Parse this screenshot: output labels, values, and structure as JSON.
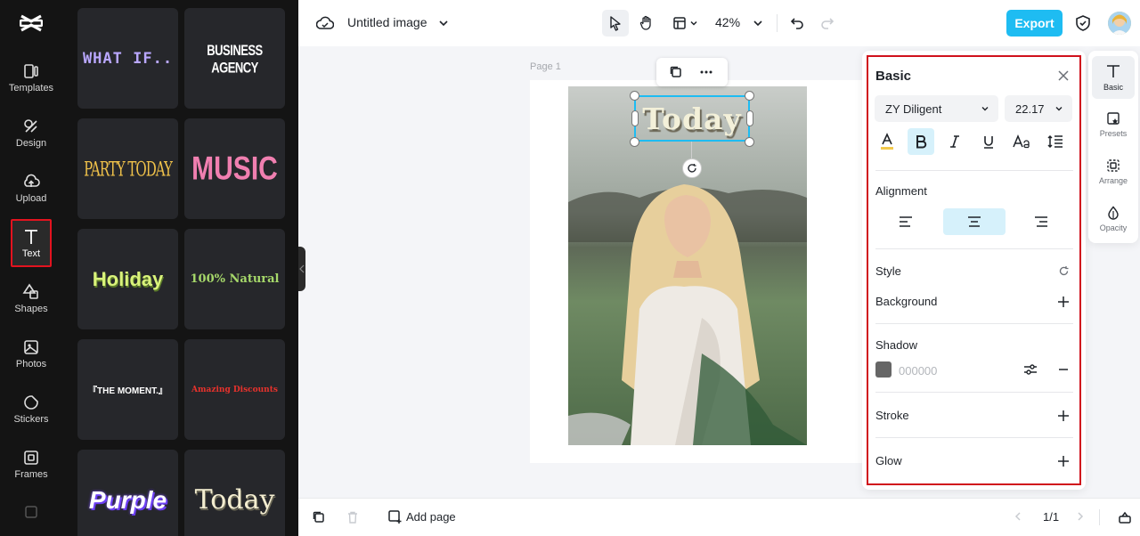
{
  "rail": {
    "items": [
      {
        "label": "Templates",
        "icon": "templates-icon"
      },
      {
        "label": "Design",
        "icon": "design-icon"
      },
      {
        "label": "Upload",
        "icon": "upload-icon"
      },
      {
        "label": "Text",
        "icon": "text-icon"
      },
      {
        "label": "Shapes",
        "icon": "shapes-icon"
      },
      {
        "label": "Photos",
        "icon": "photos-icon"
      },
      {
        "label": "Stickers",
        "icon": "stickers-icon"
      },
      {
        "label": "Frames",
        "icon": "frames-icon"
      }
    ],
    "active": "Text"
  },
  "templates": [
    {
      "text": "WHAT IF..",
      "color": "#b9a7ff"
    },
    {
      "text": "BUSINESS AGENCY",
      "color": "#ffffff"
    },
    {
      "text": "PARTY TODAY",
      "color": "#f0c24a"
    },
    {
      "text": "MUSIC",
      "color": "#f07fb0"
    },
    {
      "text": "Holiday",
      "color": "#d9f27a"
    },
    {
      "text": "100% Natural",
      "color": "#a6d86a"
    },
    {
      "text": "『THE MOMENT.』",
      "color": "#ffffff"
    },
    {
      "text": "Amazing Discounts",
      "color": "#e8322c"
    },
    {
      "text": "Purple",
      "color": "#ffffff"
    },
    {
      "text": "Today",
      "color": "#f3edd0"
    }
  ],
  "topbar": {
    "title": "Untitled image",
    "zoom": "42%",
    "export_label": "Export"
  },
  "canvas": {
    "page_label": "Page 1",
    "selected_text": "Today"
  },
  "bottombar": {
    "add_page_label": "Add page",
    "page_counter": "1/1"
  },
  "props": {
    "title": "Basic",
    "font_family": "ZY Diligent",
    "font_size": "22.17",
    "alignment_label": "Alignment",
    "style_label": "Style",
    "background_label": "Background",
    "shadow_label": "Shadow",
    "shadow_color_value": "000000",
    "shadow_swatch": "#666666",
    "stroke_label": "Stroke",
    "glow_label": "Glow"
  },
  "tabs": [
    {
      "label": "Basic",
      "active": true
    },
    {
      "label": "Presets",
      "active": false
    },
    {
      "label": "Arrange",
      "active": false
    },
    {
      "label": "Opacity",
      "active": false
    }
  ],
  "colors": {
    "accent": "#1ebcf2",
    "highlight_border": "#d0111c"
  }
}
